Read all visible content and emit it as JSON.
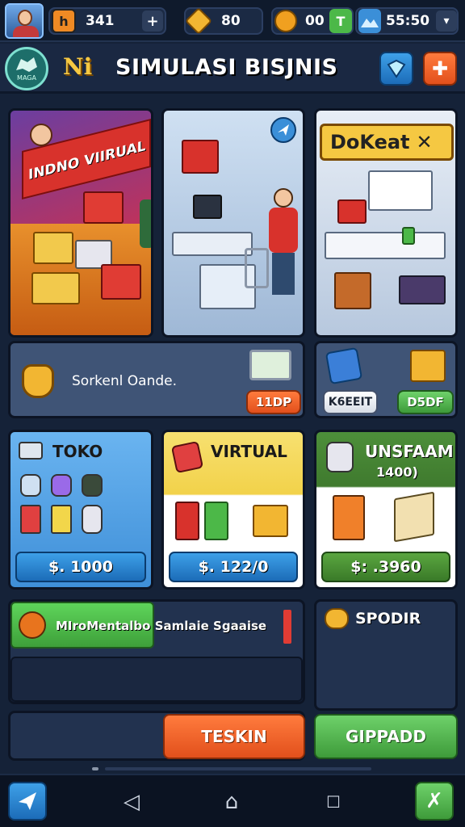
{
  "status": {
    "stat1": "341",
    "stat1_icon": "h",
    "plus": "+",
    "stat2": "80",
    "stat3": "00",
    "stat3_icon": "T",
    "time": "55:50"
  },
  "header": {
    "logo_label": "MAGA",
    "brand": "Ni",
    "title": "SIMULASI BISJNIS"
  },
  "scenes": {
    "left_sign": "INDNO VIIRUAL",
    "right_sign": "DoKeat"
  },
  "promo": {
    "text": "Sorkenl Oande.",
    "button": "11DP"
  },
  "mini": {
    "btn1": "K6EEIT",
    "btn2": "D5DF"
  },
  "shops": [
    {
      "title": "TOKO",
      "sub": "",
      "price": "$. 1000"
    },
    {
      "title": "VIRTUAL",
      "sub": "",
      "price": "$. 122/0"
    },
    {
      "title": "UNSFAAM",
      "sub": "1400)",
      "price": "$: .3960"
    }
  ],
  "bottom": {
    "bar_text": "MIroMentalbo Samlaie Sgaaise",
    "spodir": "SPODIR",
    "btn_left": "TESKIN",
    "btn_right": "GIPPADD"
  },
  "colors": {
    "accent_orange": "#e2501c",
    "accent_green": "#3e9b3a",
    "bg": "#152238"
  }
}
